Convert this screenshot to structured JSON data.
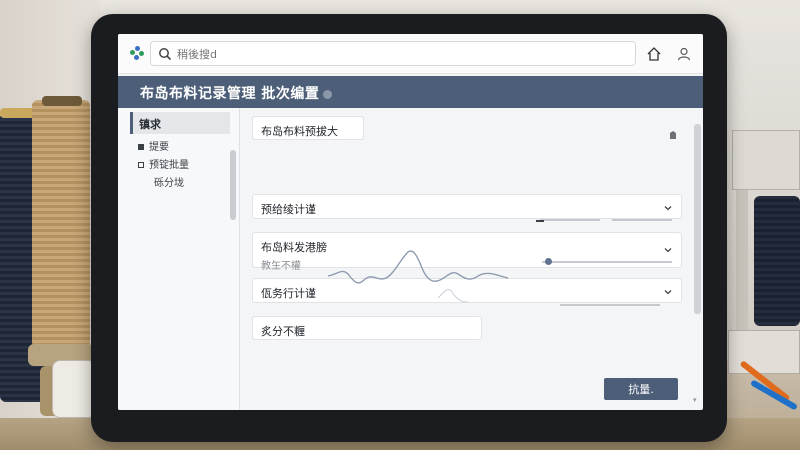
{
  "browser": {
    "search_placeholder": "稍後搜d"
  },
  "header": {
    "title": "布岛布料记录管理 批次编置"
  },
  "sidebar": {
    "active": "镇求",
    "items": [
      {
        "label": "提要"
      },
      {
        "label": "预锭批量"
      },
      {
        "label": "砾分垅"
      }
    ]
  },
  "main": {
    "top_button": "布岛布料预拔大",
    "rows": [
      {
        "label": "预给绫计谨"
      },
      {
        "label": "布岛料发港膀",
        "sub": "教玍不權"
      },
      {
        "label": "佤务行计谨"
      },
      {
        "label": "炙分不糎"
      }
    ],
    "primary_button": "抗量."
  },
  "colors": {
    "header_bg": "#4d5f78",
    "accent": "#4d5f78"
  },
  "icons": {
    "logo": "app-logo-icon",
    "search": "search-icon",
    "home": "home-icon",
    "user": "user-icon",
    "expand": "chevron-down-icon"
  }
}
